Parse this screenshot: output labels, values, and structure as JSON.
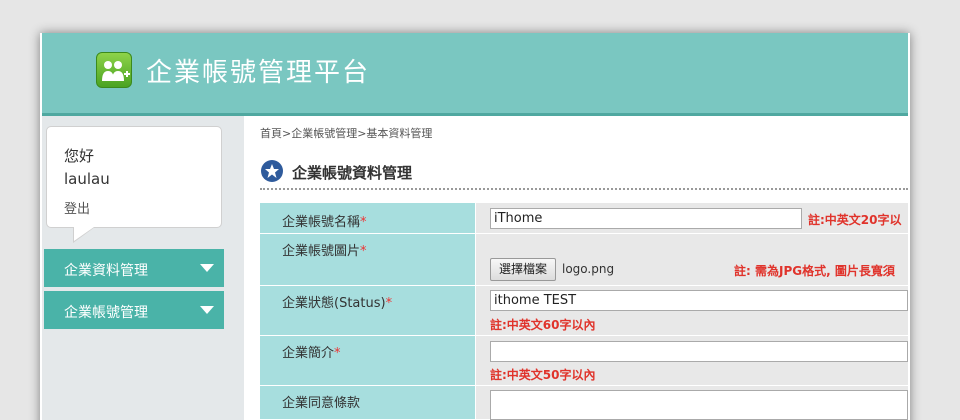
{
  "app": {
    "title": "企業帳號管理平台"
  },
  "user": {
    "greeting": "您好",
    "name": "laulau",
    "logout": "登出"
  },
  "sidebar": {
    "items": [
      {
        "label": "企業資料管理"
      },
      {
        "label": "企業帳號管理"
      }
    ]
  },
  "breadcrumb": "首頁>企業帳號管理>基本資料管理",
  "section": {
    "title": "企業帳號資料管理"
  },
  "form": {
    "name": {
      "label": "企業帳號名稱",
      "required": "*",
      "value": "iThome",
      "note": "註:中英文20字以"
    },
    "image": {
      "label": "企業帳號圖片",
      "required": "*",
      "button": "選擇檔案",
      "filename": "logo.png",
      "note": "註: 需為JPG格式, 圖片長寬須"
    },
    "status": {
      "label": "企業狀態(Status)",
      "required": "*",
      "value": "ithome TEST",
      "note": "註:中英文60字以內"
    },
    "intro": {
      "label": "企業簡介",
      "required": "*",
      "value": "",
      "note": "註:中英文50字以內"
    },
    "terms": {
      "label": "企業同意條款",
      "value": ""
    }
  },
  "colors": {
    "header": "#7ac7c1",
    "menu": "#4ab3a8",
    "label_bg": "#a7dede",
    "note": "#e0332b"
  }
}
